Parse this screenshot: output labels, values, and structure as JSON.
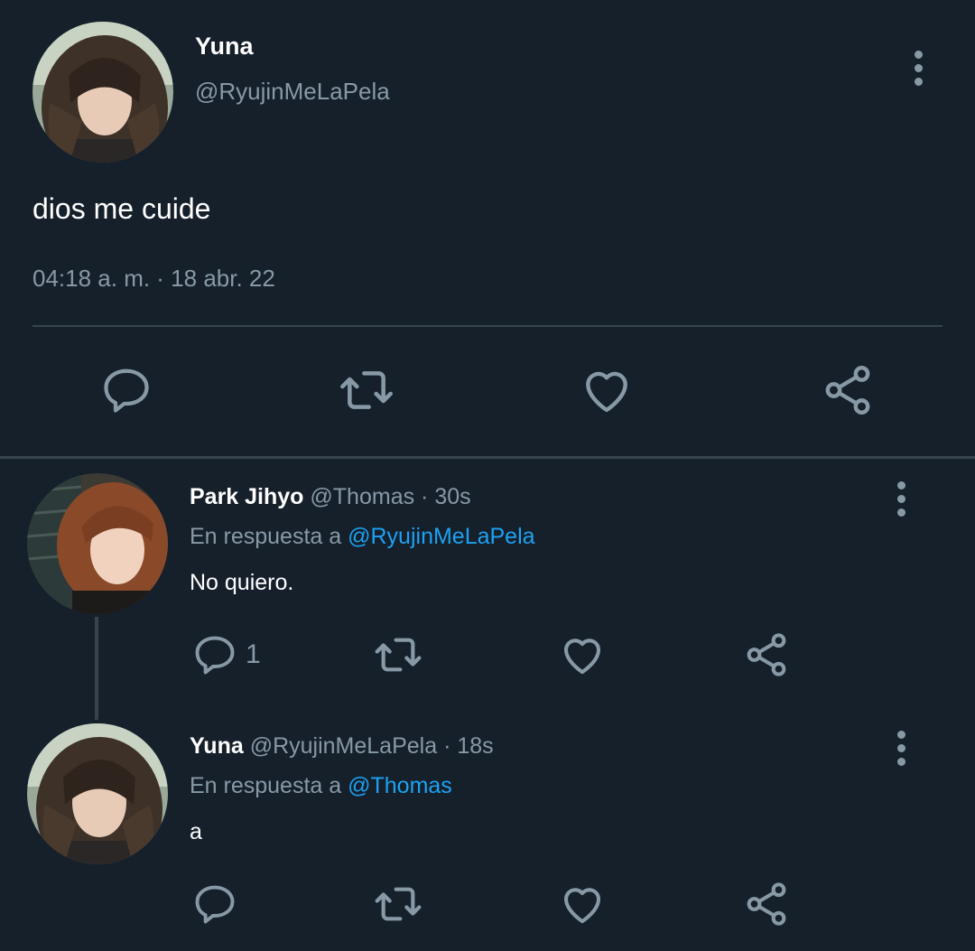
{
  "main_tweet": {
    "name": "Yuna",
    "handle": "@RyujinMeLaPela",
    "text": "dios me cuide",
    "timestamp": "04:18 a. m. · 18 abr. 22",
    "actions": [
      "reply-icon",
      "retweet-icon",
      "like-icon",
      "share-icon"
    ]
  },
  "replies": [
    {
      "name": "Park Jihyo",
      "handle": "@Thomas",
      "time": "· 30s",
      "in_reply_prefix": "En respuesta a",
      "in_reply_to": "@RyujinMeLaPela",
      "text": "No quiero.",
      "reply_count": "1"
    },
    {
      "name": "Yuna",
      "handle": "@RyujinMeLaPela",
      "time": "· 18s",
      "in_reply_prefix": "En respuesta a",
      "in_reply_to": "@Thomas",
      "text": "a"
    }
  ],
  "colors": {
    "background": "#15202b",
    "secondary_text": "#8899a6",
    "link": "#1da1f2",
    "divider": "#38444d"
  }
}
